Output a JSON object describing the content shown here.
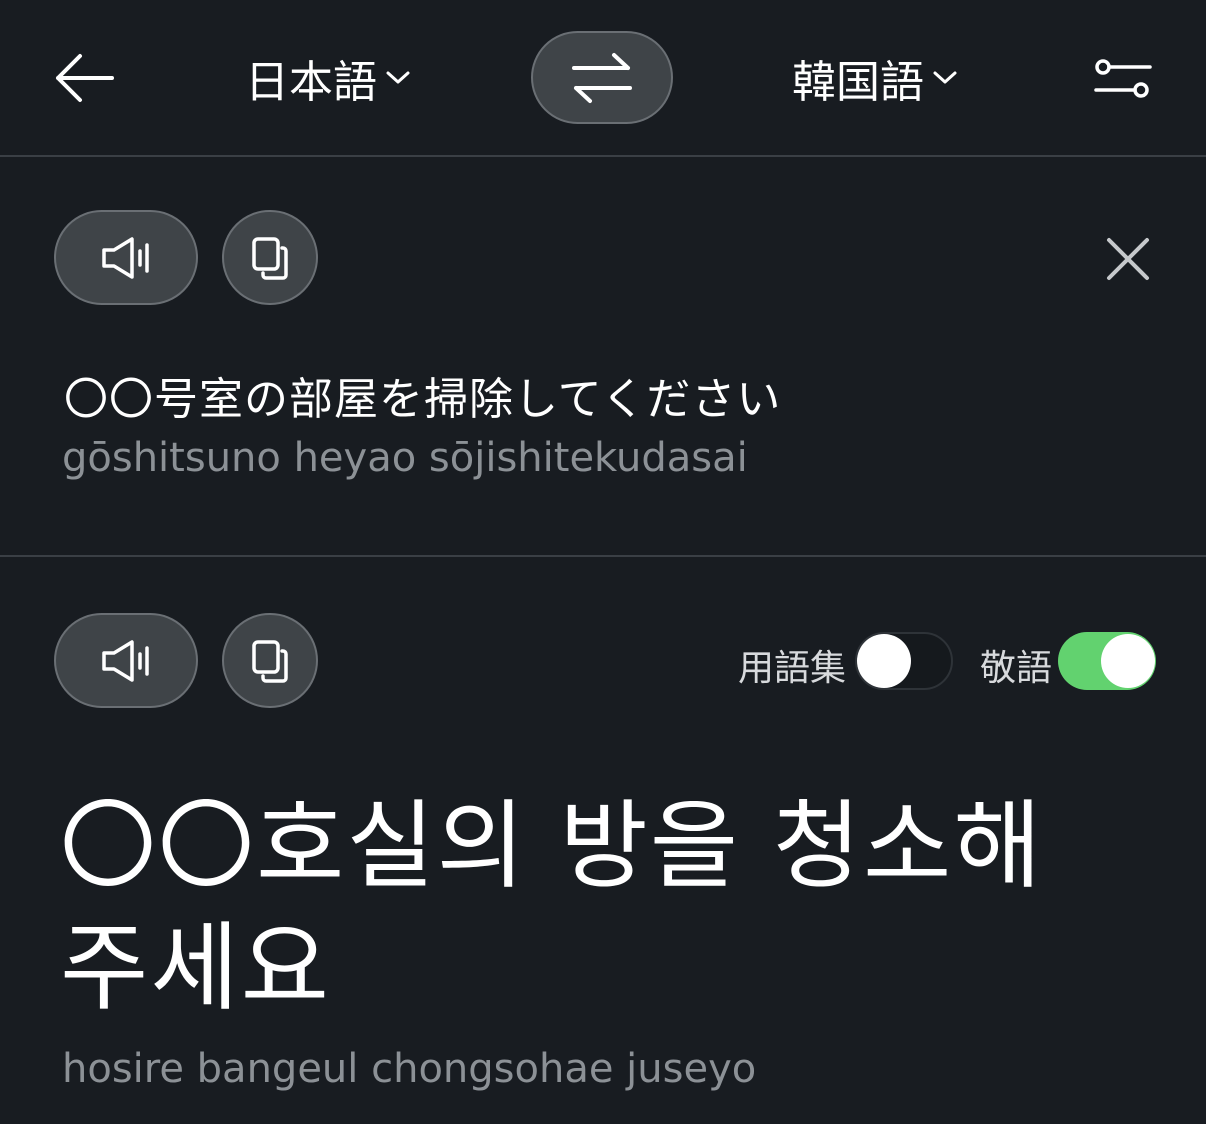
{
  "header": {
    "back_icon": "arrow-left-icon",
    "source_language": "日本語",
    "target_language": "韓国語",
    "swap_icon": "swap-arrows-icon",
    "settings_icon": "sliders-icon"
  },
  "source": {
    "text": "〇〇号室の部屋を掃除してください",
    "romanization": "gōshitsuno heyao sōjishitekudasai",
    "speak_icon": "speaker-icon",
    "copy_icon": "copy-icon",
    "close_icon": "close-icon"
  },
  "target": {
    "text": "〇〇호실의 방을 청소해 주세요",
    "romanization": "hosire bangeul chongsohae juseyo",
    "speak_icon": "speaker-icon",
    "copy_icon": "copy-icon",
    "glossary_label": "用語集",
    "glossary_on": false,
    "honorific_label": "敬語",
    "honorific_on": true
  },
  "colors": {
    "background": "#181c21",
    "toggle_on": "#62d26f",
    "secondary_text": "#8c9196"
  }
}
